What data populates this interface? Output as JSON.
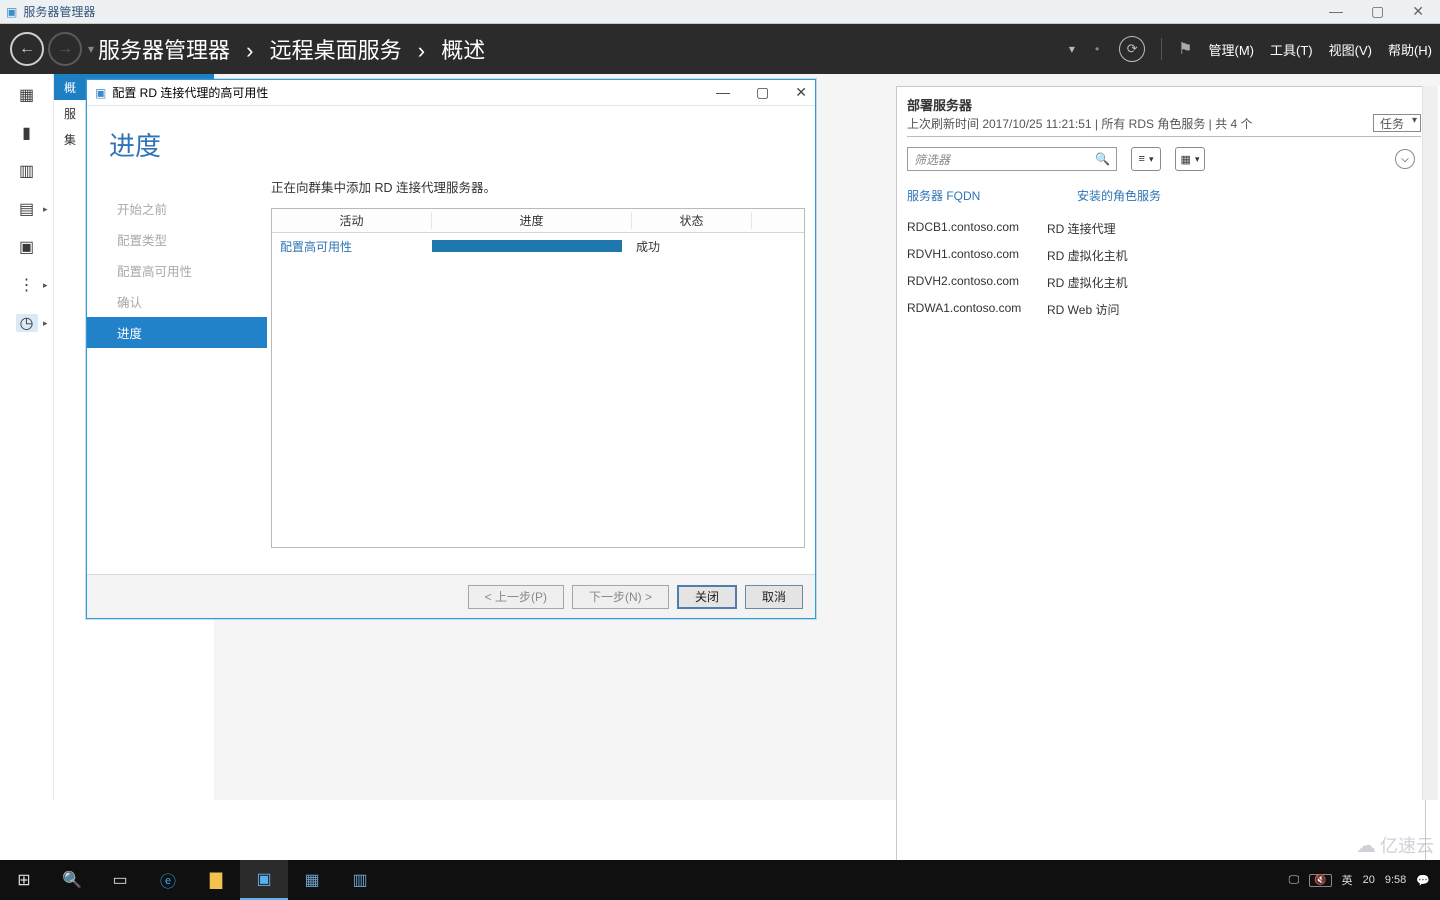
{
  "app": {
    "title": "服务器管理器"
  },
  "breadcrumb": {
    "root": "服务器管理器",
    "level1": "远程桌面服务",
    "level2": "概述"
  },
  "topmenu": {
    "manage": "管理(M)",
    "tools": "工具(T)",
    "view": "视图(V)",
    "help": "帮助(H)"
  },
  "leftnav": {
    "items": [
      "概",
      "服",
      "集"
    ]
  },
  "dialog": {
    "title": "配置 RD 连接代理的高可用性",
    "heading": "进度",
    "steps": [
      "开始之前",
      "配置类型",
      "配置高可用性",
      "确认",
      "进度"
    ],
    "active_step_index": 4,
    "message": "正在向群集中添加 RD 连接代理服务器。",
    "columns": {
      "activity": "活动",
      "progress": "进度",
      "status": "状态"
    },
    "rows": [
      {
        "activity": "配置高可用性",
        "progress": 100,
        "status": "成功"
      }
    ],
    "buttons": {
      "prev": "< 上一步(P)",
      "next": "下一步(N) >",
      "close": "关闭",
      "cancel": "取消"
    }
  },
  "deploy": {
    "title": "部署服务器",
    "refresh_line": "上次刷新时间 2017/10/25 11:21:51 | 所有 RDS 角色服务 | 共 4 个",
    "task_label": "任务",
    "filter_placeholder": "筛选器",
    "headers": {
      "fqdn": "服务器 FQDN",
      "role": "安装的角色服务"
    },
    "rows": [
      {
        "fqdn": "RDCB1.contoso.com",
        "role": "RD 连接代理"
      },
      {
        "fqdn": "RDVH1.contoso.com",
        "role": "RD 虚拟化主机"
      },
      {
        "fqdn": "RDVH2.contoso.com",
        "role": "RD 虚拟化主机"
      },
      {
        "fqdn": "RDWA1.contoso.com",
        "role": "RD Web 访问"
      }
    ]
  },
  "tray": {
    "ime": "英",
    "num": "20",
    "time": "9:58"
  },
  "watermark": "亿速云"
}
